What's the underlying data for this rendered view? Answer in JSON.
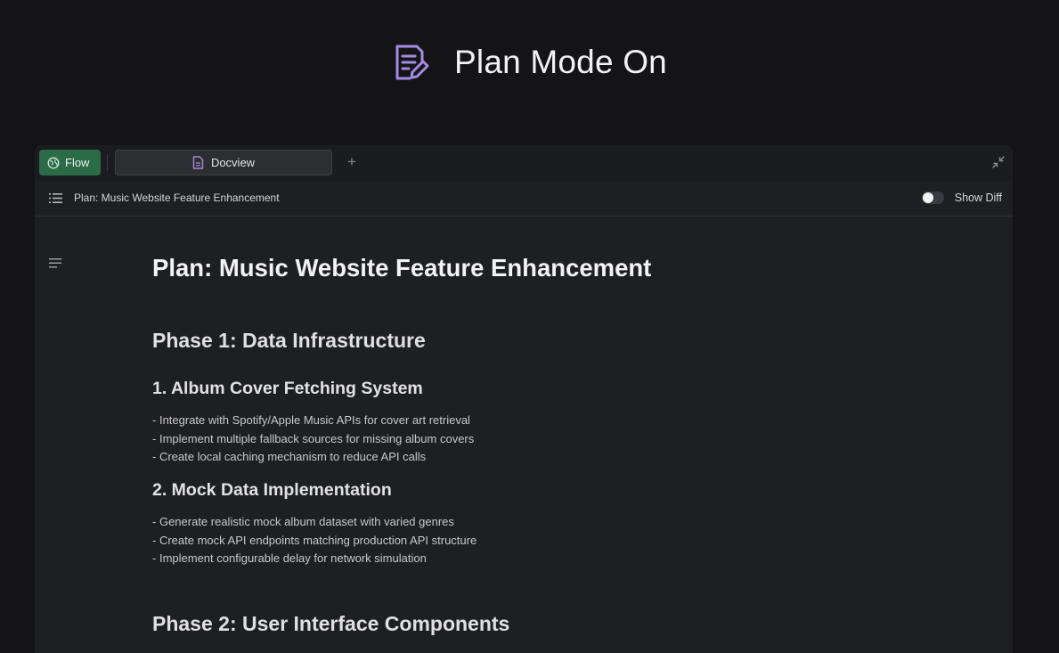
{
  "hero": {
    "title": "Plan Mode On",
    "icon": "document-edit-icon",
    "icon_color": "#a48be0"
  },
  "tabbar": {
    "flow_tab": {
      "label": "Flow",
      "icon": "globe-icon",
      "color": "#2c6b47"
    },
    "doc_tab": {
      "label": "Docview",
      "icon": "document-icon"
    },
    "add_tab_label": "+",
    "collapse_icon": "collapse-arrows-icon"
  },
  "subbar": {
    "icon": "list-icon",
    "breadcrumb": "Plan: Music Website Feature Enhancement",
    "toggle": {
      "on": false,
      "label": "Show Diff"
    }
  },
  "document": {
    "title": "Plan: Music Website Feature Enhancement",
    "phases": [
      {
        "heading": "Phase 1: Data Infrastructure",
        "sections": [
          {
            "heading": "1. Album Cover Fetching System",
            "items": [
              "Integrate with Spotify/Apple Music APIs for cover art retrieval",
              "Implement multiple fallback sources for missing album covers",
              "Create local caching mechanism to reduce API calls"
            ]
          },
          {
            "heading": "2. Mock Data Implementation",
            "items": [
              "Generate realistic mock album dataset with varied genres",
              "Create mock API endpoints matching production API structure",
              "Implement configurable delay for network simulation"
            ]
          }
        ]
      },
      {
        "heading": "Phase 2: User Interface Components",
        "sections": []
      }
    ]
  }
}
